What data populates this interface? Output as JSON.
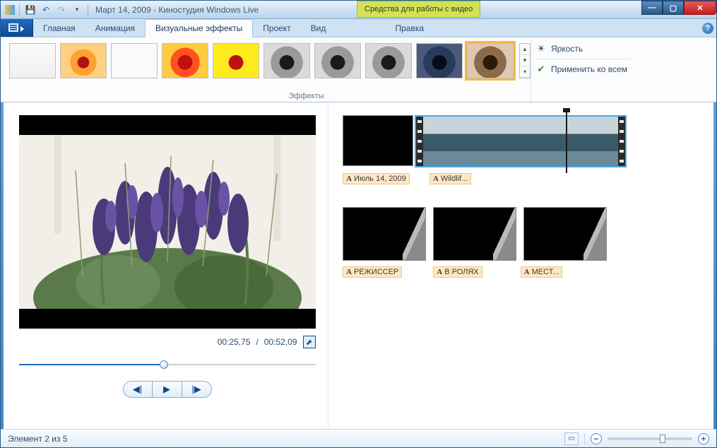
{
  "title": "Март 14, 2009 - Киностудия Windows Live",
  "context_tab": "Средства для работы с видео",
  "tabs": {
    "home": "Главная",
    "animation": "Анимация",
    "visual_fx": "Визуальные эффекты",
    "project": "Проект",
    "view": "Вид",
    "edit": "Правка"
  },
  "ribbon": {
    "group_label": "Эффекты",
    "brightness": "Яркость",
    "apply_all": "Применить ко всем"
  },
  "player": {
    "time_current": "00:25,75",
    "time_total": "00:52,09",
    "seek_percent": 49
  },
  "clips": {
    "caption1": "Июль 14, 2009",
    "caption2": "Wildlif...",
    "credit1": "РЕЖИССЕР",
    "credit2": "В РОЛЯХ",
    "credit3": "МЕСТ..."
  },
  "status": {
    "element_text": "Элемент 2 из 5",
    "zoom_percent": 62
  }
}
